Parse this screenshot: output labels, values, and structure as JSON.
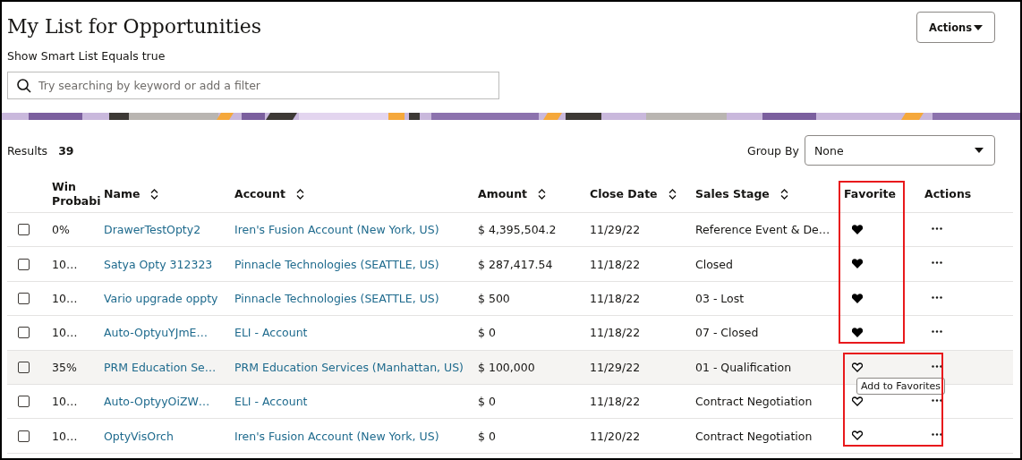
{
  "page": {
    "title": "My List for Opportunities",
    "filter_summary": "Show Smart List Equals true",
    "actions_button": "Actions"
  },
  "search": {
    "placeholder": "Try searching by keyword or add a filter"
  },
  "results": {
    "label": "Results",
    "count": "39"
  },
  "group_by": {
    "label": "Group By",
    "value": "None"
  },
  "annotation_frames": [
    {
      "includes_header": true,
      "includes_actions": false
    },
    {
      "includes_header": false,
      "includes_actions": true
    }
  ],
  "table": {
    "columns": [
      {
        "label": "Win Probabi",
        "sortable": false
      },
      {
        "label": "Name",
        "sortable": true
      },
      {
        "label": "Account",
        "sortable": true
      },
      {
        "label": "Amount",
        "sortable": true
      },
      {
        "label": "Close Date",
        "sortable": true
      },
      {
        "label": "Sales Stage",
        "sortable": true
      },
      {
        "label": "Favorite",
        "sortable": false
      },
      {
        "label": "Actions",
        "sortable": false
      }
    ],
    "rows": [
      {
        "checked": false,
        "hovered": false,
        "win": "0%",
        "name": "DrawerTestOpty2",
        "account": "Iren's Fusion Account (New York, US)",
        "amount": "$ 4,395,504.2",
        "close_date": "11/29/22",
        "stage": "Reference Event & De…",
        "favorite": true
      },
      {
        "checked": false,
        "hovered": false,
        "win": "10…",
        "name": "Satya Opty 312323",
        "account": "Pinnacle Technologies (SEATTLE, US)",
        "amount": "$ 287,417.54",
        "close_date": "11/18/22",
        "stage": "Closed",
        "favorite": true
      },
      {
        "checked": false,
        "hovered": false,
        "win": "10…",
        "name": "Vario upgrade oppty",
        "account": "Pinnacle Technologies (SEATTLE, US)",
        "amount": "$ 500",
        "close_date": "11/18/22",
        "stage": "03 - Lost",
        "favorite": true
      },
      {
        "checked": false,
        "hovered": false,
        "win": "10…",
        "name": "Auto-OptyuYJmE…",
        "account": "ELI - Account",
        "amount": "$ 0",
        "close_date": "11/18/22",
        "stage": "07 - Closed",
        "favorite": true
      },
      {
        "checked": false,
        "hovered": true,
        "win": "35%",
        "name": "PRM Education Se…",
        "account": "PRM Education Services (Manhattan, US)",
        "amount": "$ 100,000",
        "close_date": "11/29/22",
        "stage": "01 - Qualification",
        "favorite": false,
        "tooltip": "Add to Favorites"
      },
      {
        "checked": false,
        "hovered": false,
        "win": "10…",
        "name": "Auto-OptyyOiZW…",
        "account": "ELI - Account",
        "amount": "$ 0",
        "close_date": "11/18/22",
        "stage": "Contract Negotiation",
        "favorite": false
      },
      {
        "checked": false,
        "hovered": false,
        "win": "10…",
        "name": "OptyVisOrch",
        "account": "Iren's Fusion Account (New York, US)",
        "amount": "$ 0",
        "close_date": "11/20/22",
        "stage": "Contract Negotiation",
        "favorite": false
      }
    ]
  }
}
